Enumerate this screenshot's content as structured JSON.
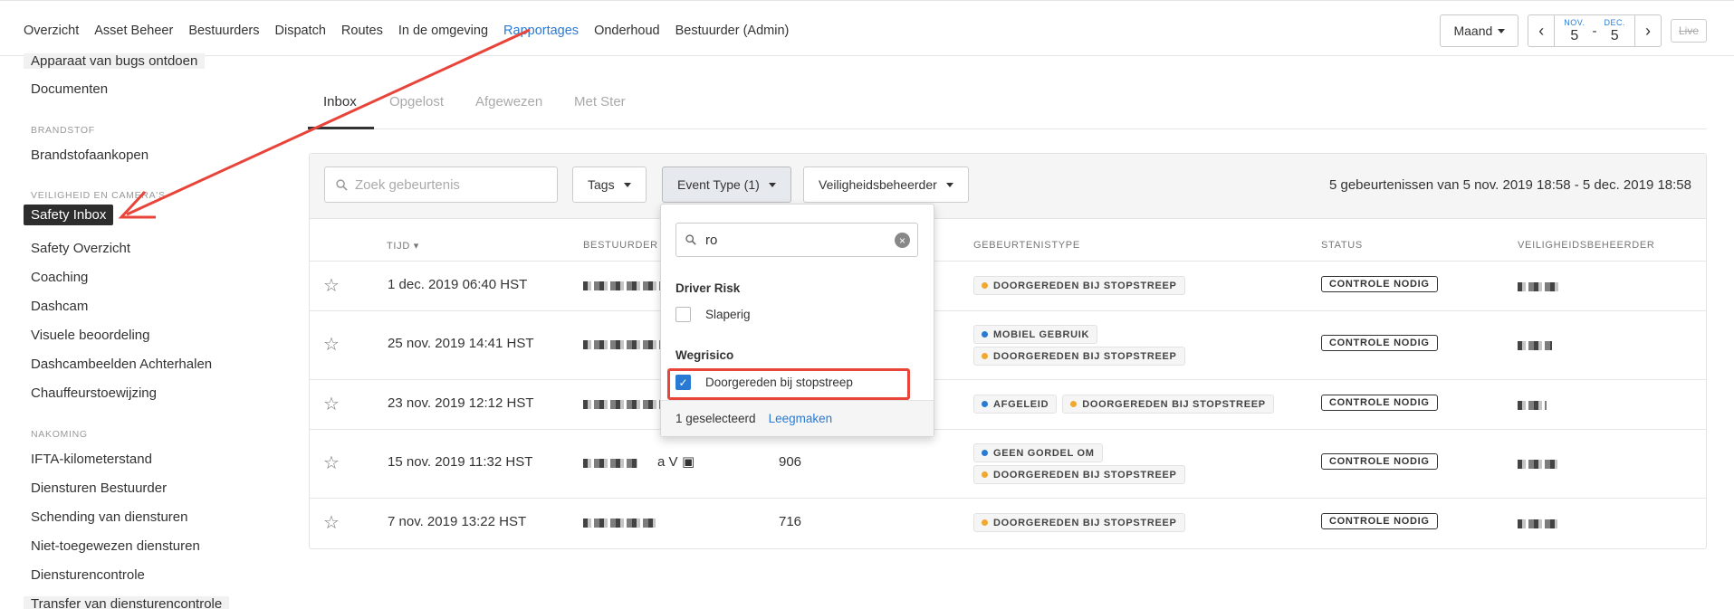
{
  "nav": {
    "items": [
      "Overzicht",
      "Asset Beheer",
      "Bestuurders",
      "Dispatch",
      "Routes",
      "In de omgeving",
      "Rapportages",
      "Onderhoud",
      "Bestuurder (Admin)"
    ],
    "active_index": 6,
    "period_label": "Maand",
    "date_from_month": "NOV.",
    "date_from_day": "5",
    "date_sep": "-",
    "date_to_month": "DEC.",
    "date_to_day": "5",
    "live_label": "Live"
  },
  "sidebar": {
    "item_bugs": "Apparaat van bugs ontdoen",
    "item_docs": "Documenten",
    "head_fuel": "BRANDSTOF",
    "item_fuel": "Brandstofaankopen",
    "head_safety": "VEILIGHEID EN CAMERA'S",
    "item_inbox": "Safety Inbox",
    "item_overview": "Safety Overzicht",
    "item_coaching": "Coaching",
    "item_dashcam": "Dashcam",
    "item_visual": "Visuele beoordeling",
    "item_retrieve": "Dashcambeelden Achterhalen",
    "item_assign": "Chauffeurstoewijzing",
    "head_compliance": "NAKOMING",
    "item_ifta": "IFTA-kilometerstand",
    "item_hos": "Diensturen Bestuurder",
    "item_violations": "Schending van diensturen",
    "item_unassigned": "Niet-toegewezen diensturen",
    "item_audit": "Diensturencontrole",
    "item_transfer": "Transfer van diensturencontrole"
  },
  "tabs": [
    "Inbox",
    "Opgelost",
    "Afgewezen",
    "Met Ster"
  ],
  "filters": {
    "search_placeholder": "Zoek gebeurtenis",
    "tags_label": "Tags",
    "event_type_label": "Event Type (1)",
    "safety_manager_label": "Veiligheidsbeheerder",
    "count_text": "5 gebeurtenissen van 5 nov. 2019 18:58 - 5 dec. 2019 18:58"
  },
  "table": {
    "headers": {
      "time": "TIJD ▾",
      "driver": "BESTUURDER",
      "event_type": "GEBEURTENISTYPE",
      "status": "STATUS",
      "manager": "VEILIGHEIDSBEHEERDER"
    },
    "rows": [
      {
        "time": "1 dec. 2019 06:40 HST",
        "driver_suffix": "",
        "value": "",
        "tags": [
          {
            "label": "DOORGEREDEN BIJ STOPSTREEP",
            "color": "#f0a830"
          }
        ],
        "status": "CONTROLE NODIG"
      },
      {
        "time": "25 nov. 2019 14:41 HST",
        "driver_suffix": "",
        "value": "",
        "tags": [
          {
            "label": "MOBIEL GEBRUIK",
            "color": "#2a7ad4"
          },
          {
            "label": "DOORGEREDEN BIJ STOPSTREEP",
            "color": "#f0a830"
          }
        ],
        "status": "CONTROLE NODIG"
      },
      {
        "time": "23 nov. 2019 12:12 HST",
        "driver_suffix": "",
        "value": "",
        "tags": [
          {
            "label": "AFGELEID",
            "color": "#2a7ad4"
          },
          {
            "label": "DOORGEREDEN BIJ STOPSTREEP",
            "color": "#f0a830"
          }
        ],
        "status": "CONTROLE NODIG"
      },
      {
        "time": "15 nov. 2019 11:32 HST",
        "driver_suffix": "a V",
        "value": "906",
        "tags": [
          {
            "label": "GEEN GORDEL OM",
            "color": "#2a7ad4"
          },
          {
            "label": "DOORGEREDEN BIJ STOPSTREEP",
            "color": "#f0a830"
          }
        ],
        "status": "CONTROLE NODIG"
      },
      {
        "time": "7 nov. 2019 13:22 HST",
        "driver_suffix": "",
        "value": "716",
        "tags": [
          {
            "label": "DOORGEREDEN BIJ STOPSTREEP",
            "color": "#f0a830"
          }
        ],
        "status": "CONTROLE NODIG"
      }
    ]
  },
  "dropdown": {
    "search_value": "ro",
    "group1": "Driver Risk",
    "opt_sleepy": "Slaperig",
    "group2": "Wegrisico",
    "opt_stop": "Doorgereden bij stopstreep",
    "selected_count": "1 geselecteerd",
    "clear_label": "Leegmaken"
  },
  "colors": {
    "accent": "#2a7ad4",
    "annotation": "#e8443a",
    "tag_yellow": "#f0a830",
    "tag_blue": "#2a7ad4"
  }
}
